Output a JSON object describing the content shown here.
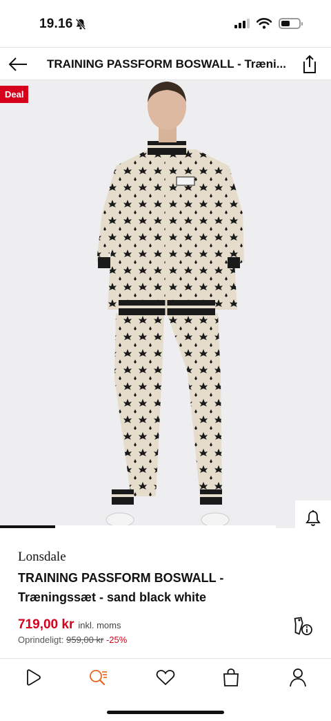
{
  "status_bar": {
    "time": "19.16",
    "icons": [
      "bell-off-icon",
      "signal-icon",
      "wifi-icon",
      "battery-icon"
    ]
  },
  "header": {
    "title": "TRAINING PASSFORM BOSWALL - Træni...",
    "back_icon": "arrow-left-icon",
    "share_icon": "share-icon"
  },
  "gallery": {
    "badge": "Deal",
    "image_progress_fraction": 0.2,
    "side_actions": [
      "bell-icon",
      "heart-icon",
      "bag-icon"
    ]
  },
  "product": {
    "brand": "Lonsdale",
    "name": "TRAINING PASSFORM BOSWALL - Træningssæt - sand black white",
    "price": "719,00 kr",
    "price_note": "inkl. moms",
    "original_label": "Oprindeligt:",
    "original_price": "959,00 kr",
    "discount": "-25%"
  },
  "bottom_nav": {
    "items": [
      "home-icon",
      "search-icon",
      "wishlist-icon",
      "bag-icon",
      "account-icon"
    ]
  },
  "colors": {
    "accent_red": "#d6001c",
    "dark": "#111111",
    "image_bg": "#eeeef0"
  }
}
